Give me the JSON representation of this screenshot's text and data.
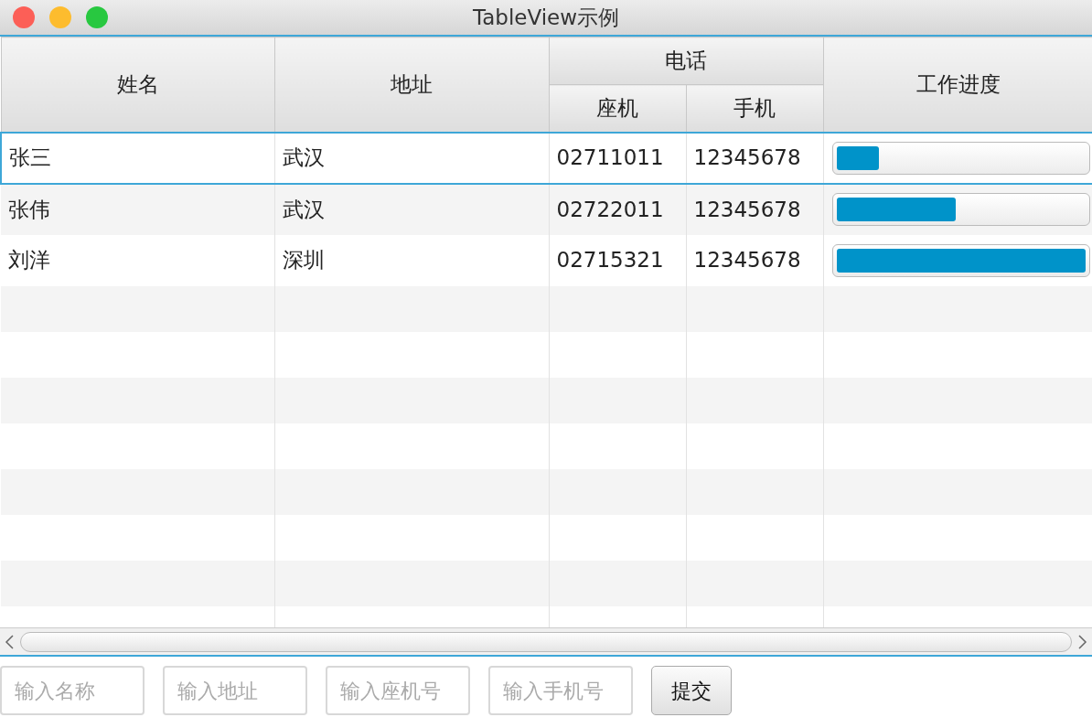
{
  "window": {
    "title": "TableView示例"
  },
  "table": {
    "columns": [
      {
        "label": "姓名"
      },
      {
        "label": "地址"
      },
      {
        "label": "电话",
        "subcolumns": [
          {
            "label": "座机"
          },
          {
            "label": "手机"
          }
        ]
      },
      {
        "label": "工作进度"
      }
    ],
    "rows": [
      {
        "name": "张三",
        "address": "武汉",
        "landline": "02711011",
        "mobile": "12345678",
        "level": 0.17,
        "selected": true
      },
      {
        "name": "张伟",
        "address": "武汉",
        "landline": "02722011",
        "mobile": "12345678",
        "level": 0.48,
        "selected": false
      },
      {
        "name": "刘洋",
        "address": "深圳",
        "landline": "02715321",
        "mobile": "12345678",
        "level": 1.0,
        "selected": false
      }
    ]
  },
  "form": {
    "fields": [
      {
        "placeholder": "输入名称"
      },
      {
        "placeholder": "输入地址"
      },
      {
        "placeholder": "输入座机号"
      },
      {
        "placeholder": "输入手机号"
      }
    ],
    "submit": "提交"
  }
}
